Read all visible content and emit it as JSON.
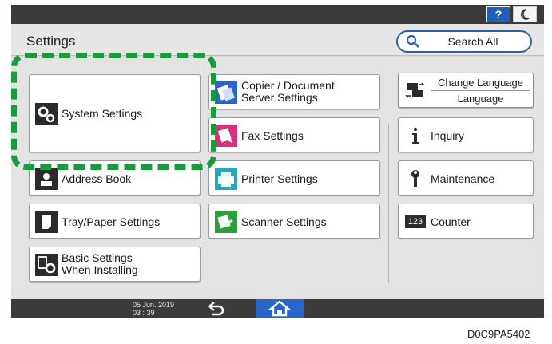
{
  "topbar": {
    "help_label": "?",
    "night_icon": "moon-icon"
  },
  "header": {
    "title": "Settings",
    "search_label": "Search All"
  },
  "tiles": {
    "system_settings": "System Settings",
    "copier_line1": "Copier / Document",
    "copier_line2": "Server Settings",
    "fax": "Fax Settings",
    "address_book": "Address Book",
    "printer": "Printer Settings",
    "tray_paper": "Tray/Paper Settings",
    "scanner": "Scanner Settings",
    "basic_line1": "Basic Settings",
    "basic_line2": "When Installing"
  },
  "right_panel": {
    "change_language": "Change Language",
    "language": "Language",
    "inquiry": "Inquiry",
    "maintenance": "Maintenance",
    "counter": "Counter",
    "counter_icon_text": "123"
  },
  "footer": {
    "date": "05 Jun. 2019",
    "time": "03 : 39"
  },
  "figure_id": "D0C9PA5402",
  "colors": {
    "accent_blue": "#2a66c9",
    "highlight_green": "#1a9a3a",
    "fax_pink": "#d6307a",
    "scanner_green": "#2f9e3a"
  }
}
